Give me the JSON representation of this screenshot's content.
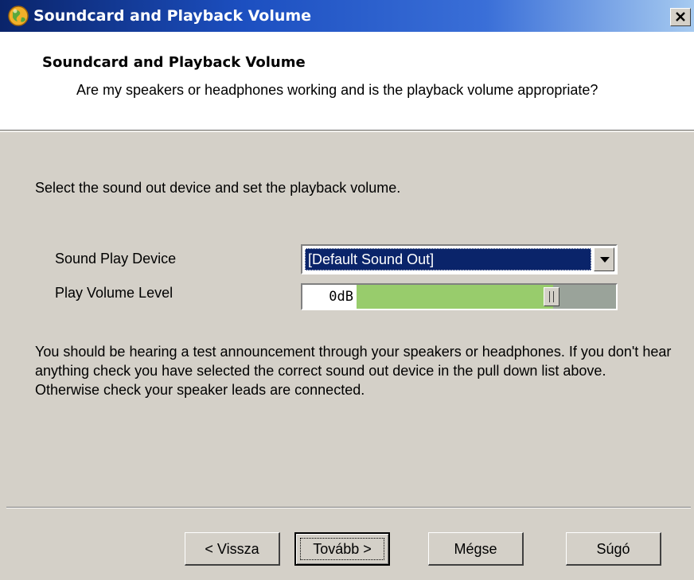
{
  "window": {
    "title": "Soundcard and Playback Volume"
  },
  "header": {
    "title": "Soundcard and Playback Volume",
    "subtitle": "Are my speakers or headphones working and is the playback volume appropriate?"
  },
  "body": {
    "instruction": "Select the sound out device and set the playback volume.",
    "device_label": "Sound Play Device",
    "device_selected": "[Default Sound Out]",
    "volume_label": "Play Volume Level",
    "volume_readout": "0dB",
    "volume_level_fraction": 0.8,
    "info_text": "You should be hearing a test announcement through your speakers or headphones. If you don't hear anything check you have selected the correct sound out device in the pull down list above. Otherwise check your speaker leads are connected."
  },
  "footer": {
    "back_label": "< Vissza",
    "next_label": "Tovább >",
    "cancel_label": "Mégse",
    "help_label": "Súgó"
  },
  "colors": {
    "titlebar": "#0a246a",
    "selection": "#0a246a",
    "volume_fill": "#98cc6c",
    "volume_track": "#9aa39a",
    "face": "#d4d0c8"
  },
  "icons": {
    "app": "globe-app-icon",
    "close": "close-icon",
    "dropdown": "chevron-down-icon"
  }
}
